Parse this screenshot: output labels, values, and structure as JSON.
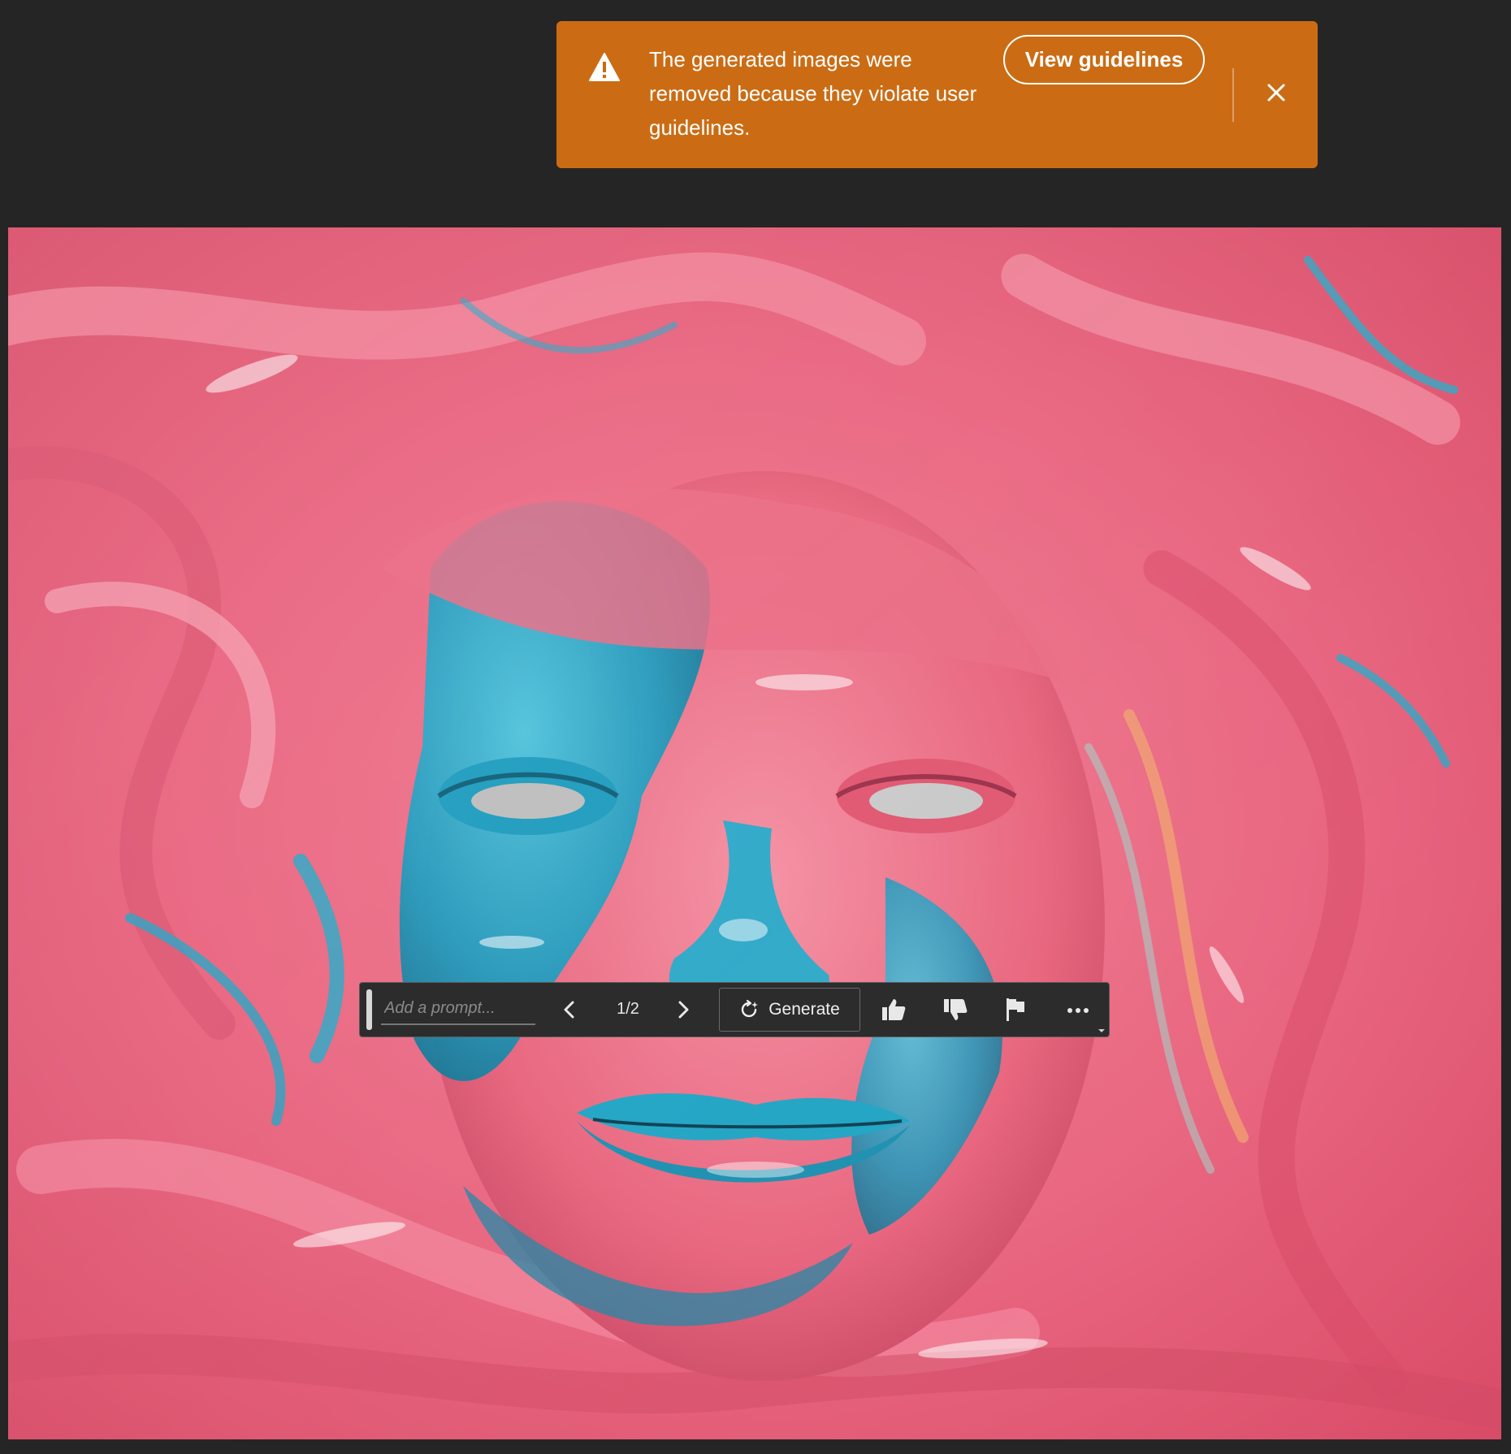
{
  "toast": {
    "message": "The generated images were removed because they violate user guidelines.",
    "button_label": "View guidelines",
    "icon": "warning-icon",
    "close_icon": "close-icon",
    "background_color": "#CB6C14"
  },
  "canvas": {
    "image_subject": "AI-generated image"
  },
  "toolbar": {
    "prompt_placeholder": "Add a prompt...",
    "prompt_value": "",
    "page_counter": "1/2",
    "generate_label": "Generate",
    "icons": [
      "chevron-left-icon",
      "chevron-right-icon",
      "generate-icon",
      "thumbs-up-icon",
      "thumbs-down-icon",
      "flag-icon",
      "more-icon"
    ]
  },
  "colors": {
    "app_background": "#252525",
    "toolbar_background": "#2c2c2c",
    "paint_pink": "#E7667F",
    "paint_teal": "#1FA4C4"
  }
}
